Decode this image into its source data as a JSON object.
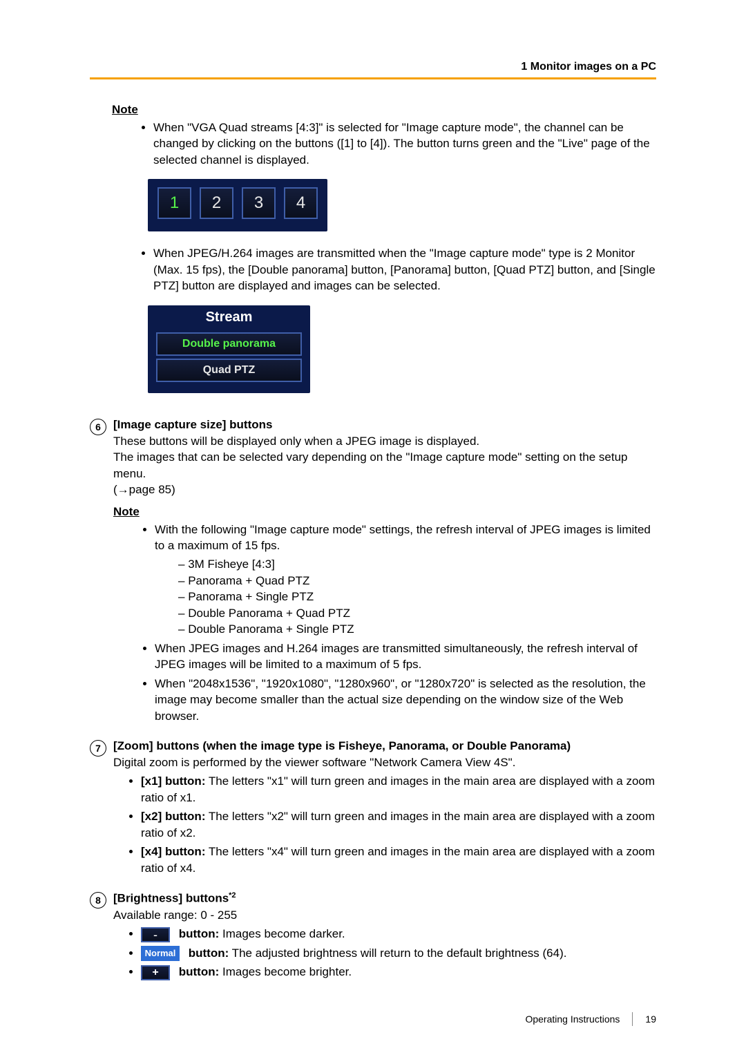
{
  "header": {
    "section_title": "1 Monitor images on a PC"
  },
  "note_label": "Note",
  "note1": {
    "bullet1": "When \"VGA Quad streams [4:3]\" is selected for \"Image capture mode\", the channel can be changed by clicking on the buttons ([1] to [4]). The button turns green and the \"Live\" page of the selected channel is displayed."
  },
  "channels": {
    "items": [
      {
        "label": "1",
        "active": true
      },
      {
        "label": "2",
        "active": false
      },
      {
        "label": "3",
        "active": false
      },
      {
        "label": "4",
        "active": false
      }
    ]
  },
  "note1b": "When JPEG/H.264 images are transmitted when the \"Image capture mode\" type is 2 Monitor (Max. 15 fps), the [Double panorama] button, [Panorama] button, [Quad PTZ] button, and [Single PTZ] button are displayed and images can be selected.",
  "stream": {
    "title": "Stream",
    "btn1": "Double panorama",
    "btn2": "Quad PTZ"
  },
  "item6": {
    "number": "6",
    "title": "[Image capture size] buttons",
    "p1": "These buttons will be displayed only when a JPEG image is displayed.",
    "p2": "The images that can be selected vary depending on the \"Image capture mode\" setting on the setup menu.",
    "p3": "(→page 85)",
    "note_bullet1": "With the following \"Image capture mode\" settings, the refresh interval of JPEG images is limited to a maximum of 15 fps.",
    "modes": [
      "3M Fisheye [4:3]",
      "Panorama + Quad PTZ",
      "Panorama + Single PTZ",
      "Double Panorama + Quad PTZ",
      "Double Panorama + Single PTZ"
    ],
    "note_bullet2": "When JPEG images and H.264 images are transmitted simultaneously, the refresh interval of JPEG images will be limited to a maximum of 5 fps.",
    "note_bullet3": "When \"2048x1536\", \"1920x1080\", \"1280x960\", or \"1280x720\" is selected as the resolution, the image may become smaller than the actual size depending on the window size of the Web browser."
  },
  "item7": {
    "number": "7",
    "title": "[Zoom] buttons (when the image type is Fisheye, Panorama, or Double Panorama)",
    "p1": "Digital zoom is performed by the viewer software \"Network Camera View 4S\".",
    "x1_label": "[x1] button:",
    "x1_text": " The letters \"x1\" will turn green and images in the main area are displayed with a zoom ratio of x1.",
    "x2_label": "[x2] button:",
    "x2_text": " The letters \"x2\" will turn green and images in the main area are displayed with a zoom ratio of x2.",
    "x4_label": "[x4] button:",
    "x4_text": " The letters \"x4\" will turn green and images in the main area are displayed with a zoom ratio of x4."
  },
  "item8": {
    "number": "8",
    "title": "[Brightness] buttons",
    "footnote": "*2",
    "range": "Available range: 0 - 255",
    "minus_label": "-",
    "minus_bold": "button:",
    "minus_text": " Images become darker.",
    "normal_label": "Normal",
    "normal_bold": "button:",
    "normal_text": " The adjusted brightness will return to the default brightness (64).",
    "plus_label": "+",
    "plus_bold": "button:",
    "plus_text": " Images become brighter."
  },
  "footer": {
    "doc": "Operating Instructions",
    "page": "19"
  }
}
